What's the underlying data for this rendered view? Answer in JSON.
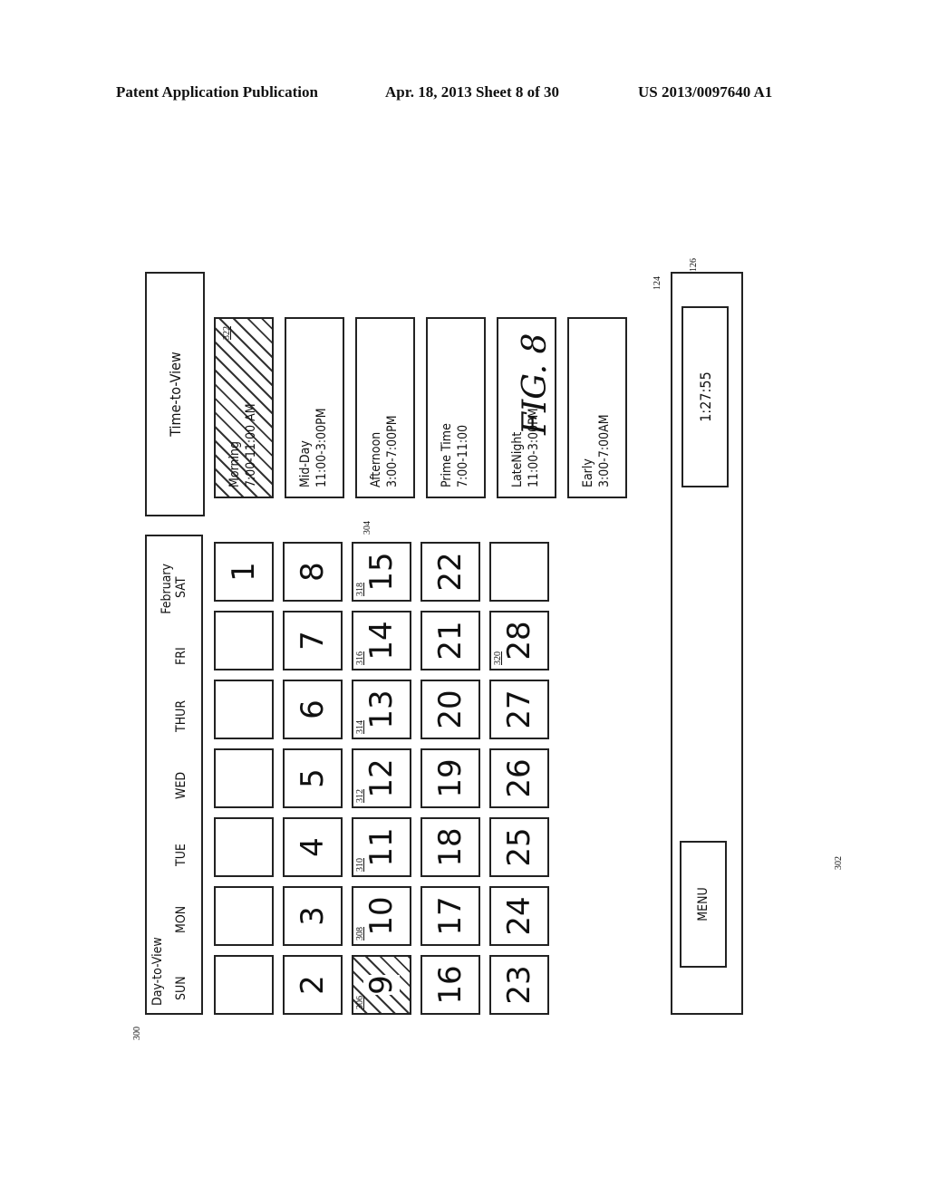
{
  "header": {
    "left": "Patent Application Publication",
    "middle": "Apr. 18, 2013  Sheet 8 of 30",
    "right": "US 2013/0097640 A1"
  },
  "figure_label": "FIG. 8",
  "day_to_view": {
    "title": "Day-to-View",
    "month": "February",
    "ref": "300",
    "grid_ref": "302",
    "weekdays": [
      "SUN",
      "MON",
      "TUE",
      "WED",
      "THUR",
      "FRI",
      "SAT"
    ],
    "weeks": [
      [
        {
          "d": ""
        },
        {
          "d": ""
        },
        {
          "d": ""
        },
        {
          "d": ""
        },
        {
          "d": ""
        },
        {
          "d": ""
        },
        {
          "d": "1"
        }
      ],
      [
        {
          "d": "2"
        },
        {
          "d": "3"
        },
        {
          "d": "4"
        },
        {
          "d": "5"
        },
        {
          "d": "6"
        },
        {
          "d": "7"
        },
        {
          "d": "8"
        }
      ],
      [
        {
          "d": "9",
          "ref": "306",
          "hatched": true
        },
        {
          "d": "10",
          "ref": "308"
        },
        {
          "d": "11",
          "ref": "310"
        },
        {
          "d": "12",
          "ref": "312"
        },
        {
          "d": "13",
          "ref": "314"
        },
        {
          "d": "14",
          "ref": "316"
        },
        {
          "d": "15",
          "ref": "318"
        }
      ],
      [
        {
          "d": "16"
        },
        {
          "d": "17"
        },
        {
          "d": "18"
        },
        {
          "d": "19"
        },
        {
          "d": "20"
        },
        {
          "d": "21"
        },
        {
          "d": "22"
        }
      ],
      [
        {
          "d": "23"
        },
        {
          "d": "24"
        },
        {
          "d": "25"
        },
        {
          "d": "26"
        },
        {
          "d": "27"
        },
        {
          "d": "28",
          "ref": "320"
        },
        {
          "d": ""
        }
      ]
    ]
  },
  "time_to_view": {
    "title": "Time-to-View",
    "ref": "304",
    "slots": [
      {
        "name": "Morning",
        "range": "7:00-11:00 AM",
        "ref": "322",
        "hatched": true
      },
      {
        "name": "Mid-Day",
        "range": "11:00-3:00PM"
      },
      {
        "name": "Afternoon",
        "range": "3:00-7:00PM"
      },
      {
        "name": "Prime Time",
        "range": "7:00-11:00"
      },
      {
        "name": "LateNight",
        "range": "11:00-3:00PM"
      },
      {
        "name": "Early",
        "range": "3:00-7:00AM"
      }
    ]
  },
  "status_bar": {
    "ref": "124",
    "clock_ref": "126",
    "clock": "1:27:55",
    "menu_label": "MENU"
  }
}
